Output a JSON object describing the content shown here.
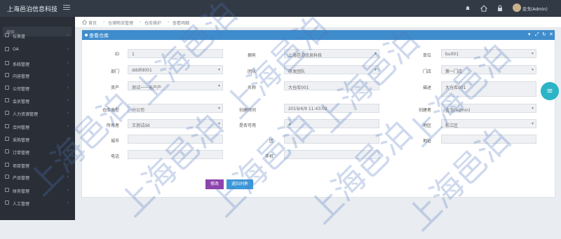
{
  "app": {
    "brand": "上海邑泊信息科技",
    "user": "金戈(Admin)"
  },
  "sidebar": {
    "search_placeholder": "搜索...",
    "items": [
      {
        "label": "仪表盘",
        "icon": "dashboard-icon"
      },
      {
        "label": "OA",
        "icon": "oa-icon"
      },
      {
        "label": "系统管理",
        "icon": "system-icon"
      },
      {
        "label": "内容管理",
        "icon": "content-icon"
      },
      {
        "label": "公司管理",
        "icon": "company-icon"
      },
      {
        "label": "会员管理",
        "icon": "member-icon"
      },
      {
        "label": "人力资源管理",
        "icon": "hr-icon"
      },
      {
        "label": "合同管理",
        "icon": "contract-icon"
      },
      {
        "label": "采购管理",
        "icon": "purchase-icon"
      },
      {
        "label": "订单管理",
        "icon": "order-icon"
      },
      {
        "label": "项目管理",
        "icon": "project-icon"
      },
      {
        "label": "产品管理",
        "icon": "product-icon"
      },
      {
        "label": "财务管理",
        "icon": "finance-icon"
      },
      {
        "label": "人工管理",
        "icon": "labor-icon"
      }
    ]
  },
  "breadcrumb": [
    "首页",
    "仓储物流管理",
    "仓库维护",
    "查看明细"
  ],
  "panel": {
    "title": "查看仓库"
  },
  "form": {
    "id_label": "ID",
    "id_value": "1",
    "owner_label": "拥有",
    "owner_value": "上海邑泊信息科技",
    "unit_label": "单位",
    "unit_value": "bu001",
    "dept_label": "部门",
    "dept_value": "dddfd001",
    "team_label": "团队",
    "team_value": "研发团队",
    "store_label": "门店",
    "store_value": "第一门店",
    "asset_label": "资产",
    "asset_value": "测试一一无产产",
    "name_label": "名称",
    "name_value": "大仓库001",
    "desc_label": "描述",
    "desc_value": "大仓库001",
    "type_label": "仓库类型",
    "type_value": "分公司",
    "created_label": "创建时间",
    "created_value": "2019/4/9 11:43:02",
    "creator_label": "创建者",
    "creator_value": "金戈(admin)",
    "holder_label": "所有者",
    "holder_value": "王测试dd",
    "available_label": "是否可用",
    "available_value": "✔",
    "region_label": "地区",
    "region_value": "松江区",
    "city_label": "城市",
    "city_value": "",
    "district_label": "区",
    "district_value": "",
    "address_label": "地址",
    "address_value": "",
    "phone_label": "电话",
    "phone_value": "",
    "mobile_label": "手机",
    "mobile_value": ""
  },
  "buttons": {
    "edit": "修改",
    "back": "返回列表"
  },
  "watermark": "上海邑泊"
}
